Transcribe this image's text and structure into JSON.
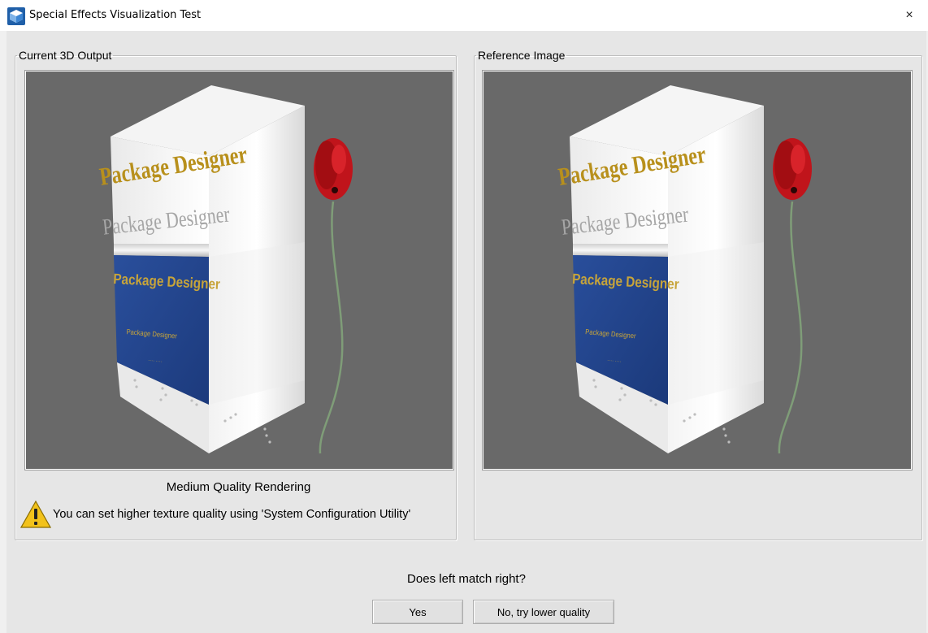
{
  "window": {
    "title": "Special Effects Visualization Test",
    "icon": "app-logo-icon",
    "close_glyph": "×"
  },
  "left_panel": {
    "legend": "Current 3D Output",
    "quality_label": "Medium Quality Rendering",
    "warning_icon": "warning-icon",
    "warning_text": "You can set higher texture quality using 'System Configuration Utility'"
  },
  "right_panel": {
    "legend": "Reference Image"
  },
  "box_art": {
    "title_gold": "Package Designer",
    "title_silver": "Package Designer",
    "band_title": "Package Designer",
    "band_small": "Package Designer",
    "band_tiny": "···· ····"
  },
  "question": "Does left match right?",
  "buttons": {
    "yes": "Yes",
    "no": "No, try lower quality"
  },
  "colors": {
    "viewport_bg": "#696969",
    "band_blue": "#23448e",
    "gold_text": "#b8901c",
    "flower_red": "#c0141b"
  }
}
